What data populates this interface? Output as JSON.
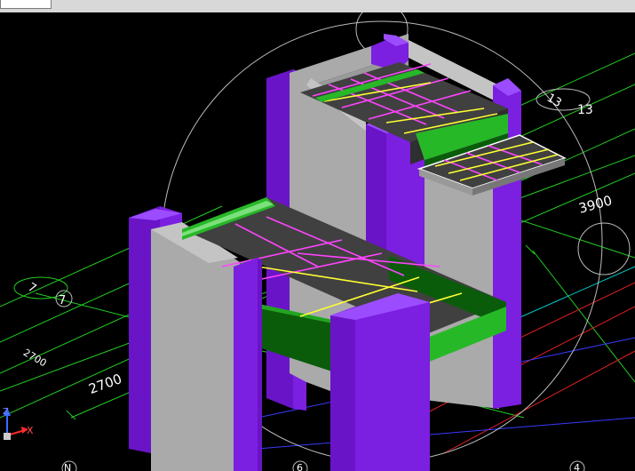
{
  "toolbar": {
    "field_value": ""
  },
  "viewport": {
    "background": "#000000",
    "axis_labels": [
      "13",
      "7",
      "N",
      "6",
      "4"
    ],
    "dimensions": [
      "3900",
      "2700",
      "2700"
    ],
    "triad": {
      "z": "Z",
      "x": "X"
    },
    "colors": {
      "columns": "#7b1fe0",
      "walls": "#aaaaaa",
      "slabs": "#404040",
      "beams_light": "#27b827",
      "beams_dark": "#0a5c0a",
      "grid_lines": "#22cc22",
      "rebar_magenta": "#ff44ff",
      "rebar_yellow": "#ffff33",
      "orbit_circle": "#bbbbbb"
    }
  }
}
